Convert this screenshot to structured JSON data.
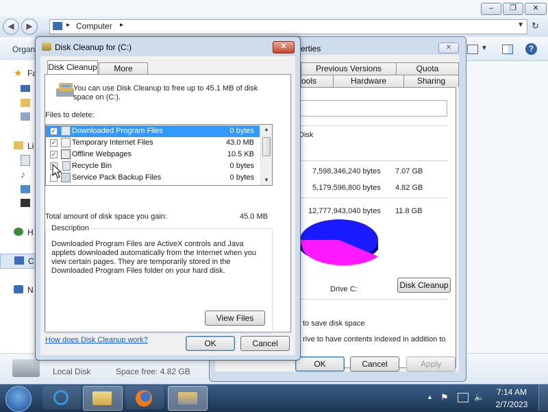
{
  "explorer": {
    "breadcrumb": "Computer",
    "cmd_left": "Organ",
    "nav_items": [
      "Fa",
      "Li",
      "H",
      "C",
      "N"
    ],
    "details": {
      "name": "Local Disk",
      "space_free": "Space free: 4.82 GB"
    }
  },
  "properties": {
    "title": "erties",
    "tabs_row1": [
      "Previous Versions",
      "Quota"
    ],
    "tabs_row2": [
      "ools",
      "Hardware",
      "Sharing"
    ],
    "type_label": "Disk",
    "used": {
      "bytes": "7,598,346,240 bytes",
      "size": "7.07 GB"
    },
    "free": {
      "bytes": "5,179,596,800 bytes",
      "size": "4.82 GB"
    },
    "capacity": {
      "bytes": "12,777,943,040 bytes",
      "size": "11.8 GB"
    },
    "drive_label": "Drive C:",
    "disk_cleanup_button": "Disk Cleanup",
    "compress_text": "to save disk space",
    "index_text": "rive to have contents indexed in addition to",
    "ok": "OK",
    "cancel": "Cancel",
    "apply": "Apply",
    "colors": {
      "used": "#1a1aff",
      "free": "#ff19ff"
    }
  },
  "disk_cleanup": {
    "title": "Disk Cleanup for  (C:)",
    "tabs": [
      "Disk Cleanup",
      "More Options"
    ],
    "intro": "You can use Disk Cleanup to free up to 45.1 MB of disk space on  (C:).",
    "files_to_delete_label": "Files to delete:",
    "files": [
      {
        "name": "Downloaded Program Files",
        "size": "0 bytes",
        "checked": true,
        "selected": true,
        "icon": "folder-icon"
      },
      {
        "name": "Temporary Internet Files",
        "size": "43.0 MB",
        "checked": true,
        "selected": false,
        "icon": "document-icon"
      },
      {
        "name": "Offline Webpages",
        "size": "10.5 KB",
        "checked": true,
        "selected": false,
        "icon": "webpage-icon"
      },
      {
        "name": "Recycle Bin",
        "size": "0 bytes",
        "checked": false,
        "selected": false,
        "icon": "recycle-bin-icon"
      },
      {
        "name": "Service Pack Backup Files",
        "size": "0 bytes",
        "checked": false,
        "selected": false,
        "icon": "backup-icon"
      }
    ],
    "total_label": "Total amount of disk space you gain:",
    "total_value": "45.0 MB",
    "description_label": "Description",
    "description": "Downloaded Program Files are ActiveX controls and Java applets downloaded automatically from the Internet when you view certain pages. They are temporarily stored in the Downloaded Program Files folder on your hard disk.",
    "view_files_button": "View Files",
    "help_link": "How does Disk Cleanup work?",
    "ok": "OK",
    "cancel": "Cancel"
  },
  "taskbar": {
    "time": "7:14 AM",
    "date": "2/7/2023",
    "apps": [
      "start-orb-icon",
      "internet-explorer-icon",
      "windows-explorer-icon",
      "firefox-icon",
      "disk-cleanup-icon"
    ]
  }
}
